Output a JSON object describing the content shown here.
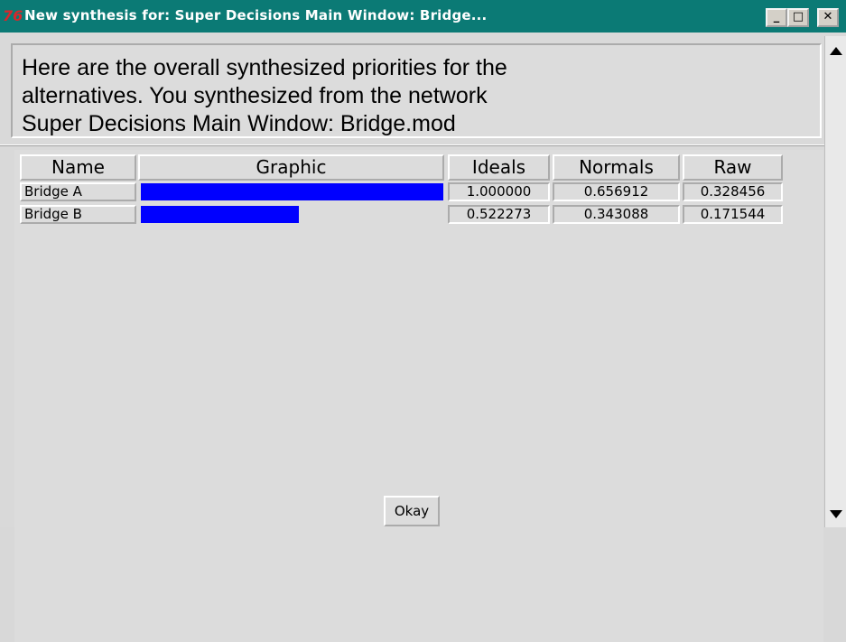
{
  "window": {
    "icon_text": "76",
    "title": "New synthesis for: Super Decisions Main Window: Bridge...",
    "controls": {
      "minimize": "_",
      "maximize": "□",
      "close": "✕"
    }
  },
  "message": {
    "text": "Here are the overall synthesized priorities for the\nalternatives.  You synthesized from the network\nSuper Decisions Main Window: Bridge.mod"
  },
  "table": {
    "headers": {
      "name": "Name",
      "graphic": "Graphic",
      "ideals": "Ideals",
      "normals": "Normals",
      "raw": "Raw"
    },
    "rows": [
      {
        "name": "Bridge A",
        "ideals": "1.000000",
        "normals": "0.656912",
        "raw": "0.328456",
        "bar_fraction": 1.0
      },
      {
        "name": "Bridge B",
        "ideals": "0.522273",
        "normals": "0.343088",
        "raw": "0.171544",
        "bar_fraction": 0.522273
      }
    ],
    "bar_color": "#0000ff"
  },
  "footer": {
    "okay_label": "Okay"
  }
}
